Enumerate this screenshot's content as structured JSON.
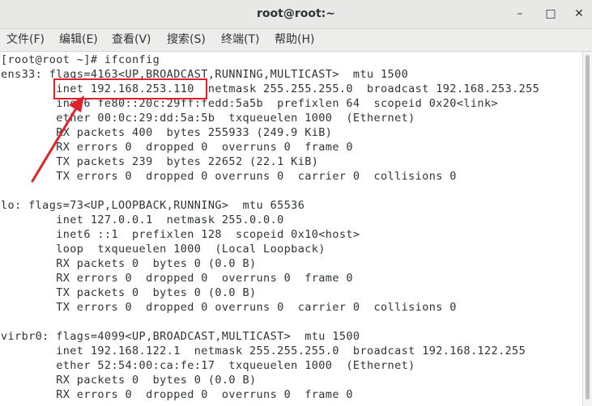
{
  "window": {
    "title": "root@root:~",
    "minimize_glyph": "–",
    "maximize_glyph": "□",
    "close_glyph": "✕"
  },
  "menu": [
    {
      "label": "文件(F)"
    },
    {
      "label": "编辑(E)"
    },
    {
      "label": "查看(V)"
    },
    {
      "label": "搜索(S)"
    },
    {
      "label": "终端(T)"
    },
    {
      "label": "帮助(H)"
    }
  ],
  "terminal": {
    "lines": [
      "[root@root ~]# ifconfig",
      "ens33: flags=4163<UP,BROADCAST,RUNNING,MULTICAST>  mtu 1500",
      "        inet 192.168.253.110  netmask 255.255.255.0  broadcast 192.168.253.255",
      "        inet6 fe80::20c:29ff:fedd:5a5b  prefixlen 64  scopeid 0x20<link>",
      "        ether 00:0c:29:dd:5a:5b  txqueuelen 1000  (Ethernet)",
      "        RX packets 400  bytes 255933 (249.9 KiB)",
      "        RX errors 0  dropped 0  overruns 0  frame 0",
      "        TX packets 239  bytes 22652 (22.1 KiB)",
      "        TX errors 0  dropped 0 overruns 0  carrier 0  collisions 0",
      "",
      "lo: flags=73<UP,LOOPBACK,RUNNING>  mtu 65536",
      "        inet 127.0.0.1  netmask 255.0.0.0",
      "        inet6 ::1  prefixlen 128  scopeid 0x10<host>",
      "        loop  txqueuelen 1000  (Local Loopback)",
      "        RX packets 0  bytes 0 (0.0 B)",
      "        RX errors 0  dropped 0  overruns 0  frame 0",
      "        TX packets 0  bytes 0 (0.0 B)",
      "        TX errors 0  dropped 0 overruns 0  carrier 0  collisions 0",
      "",
      "virbr0: flags=4099<UP,BROADCAST,MULTICAST>  mtu 1500",
      "        inet 192.168.122.1  netmask 255.255.255.0  broadcast 192.168.122.255",
      "        ether 52:54:00:ca:fe:17  txqueuelen 1000  (Ethernet)",
      "        RX packets 0  bytes 0 (0.0 B)",
      "        RX errors 0  dropped 0  overruns 0  frame 0"
    ]
  },
  "annotation": {
    "color": "#e0202a"
  }
}
